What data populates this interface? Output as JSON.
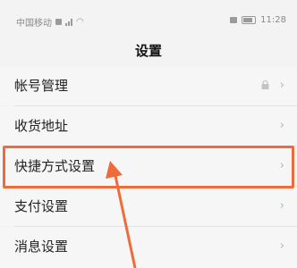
{
  "status_bar": {
    "carrier": "中国移动",
    "time": "11:28"
  },
  "header": {
    "title": "设置"
  },
  "settings": {
    "items": [
      {
        "label": "帐号管理"
      },
      {
        "label": "收货地址"
      },
      {
        "label": "快捷方式设置"
      },
      {
        "label": "支付设置"
      },
      {
        "label": "消息设置"
      }
    ],
    "chevron": "›"
  },
  "annotation": {
    "color": "#f06b3a"
  }
}
